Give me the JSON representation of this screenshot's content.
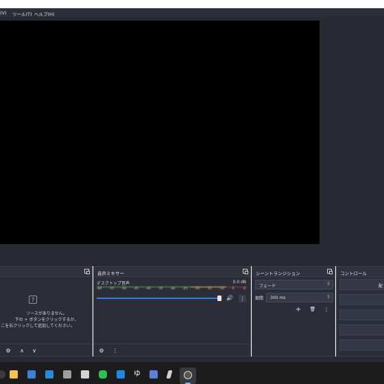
{
  "menubar": {
    "view_fragment": "(V)",
    "tools": "ツール(T)",
    "help": "ヘルプ(H)"
  },
  "sources": {
    "title": "",
    "empty_line1": "ソースがありません。",
    "empty_line2": "下の + ボタンをクリックするか、",
    "empty_line3": "ここを右クリックして追加してください。",
    "help_icon_glyph": "?",
    "buttons": {
      "settings": "⚙",
      "up": "∧",
      "down": "∨"
    }
  },
  "mixer": {
    "title": "音声ミキサー",
    "track_name": "デスクトップ音声",
    "level": "0.0 dB",
    "ticks": [
      "-60",
      "-55",
      "-50",
      "-45",
      "-40",
      "-35",
      "-30",
      "-25",
      "-20",
      "-15",
      "-10",
      "-5",
      "0"
    ],
    "volume_fraction": 0.96,
    "buttons": {
      "settings": "⚙",
      "menu": "⋮"
    }
  },
  "transitions": {
    "title": "シーントランジション",
    "type_value": "フェード",
    "duration_label": "期間",
    "duration_value": "300 ms",
    "buttons": {
      "add": "+",
      "remove": "🗑",
      "menu": "⋮"
    }
  },
  "controls": {
    "title": "コントロール",
    "first_button": "配"
  },
  "taskbar": {
    "icons": [
      "obs-icon",
      "explorer-icon",
      "calendar-icon",
      "mail-icon",
      "store-icon",
      "terminal-icon",
      "line-icon",
      "app-icon",
      "yu-icon",
      "image-icon",
      "pen-icon",
      "obs-studio-icon"
    ],
    "colors": {
      "bg": "#1c1c1c",
      "accent": "#78b4ff"
    },
    "yu_glyph": "ゆ"
  },
  "colors": {
    "panel": "#2b2e38",
    "preview": "#000000",
    "slider": "#2e7fd3"
  }
}
